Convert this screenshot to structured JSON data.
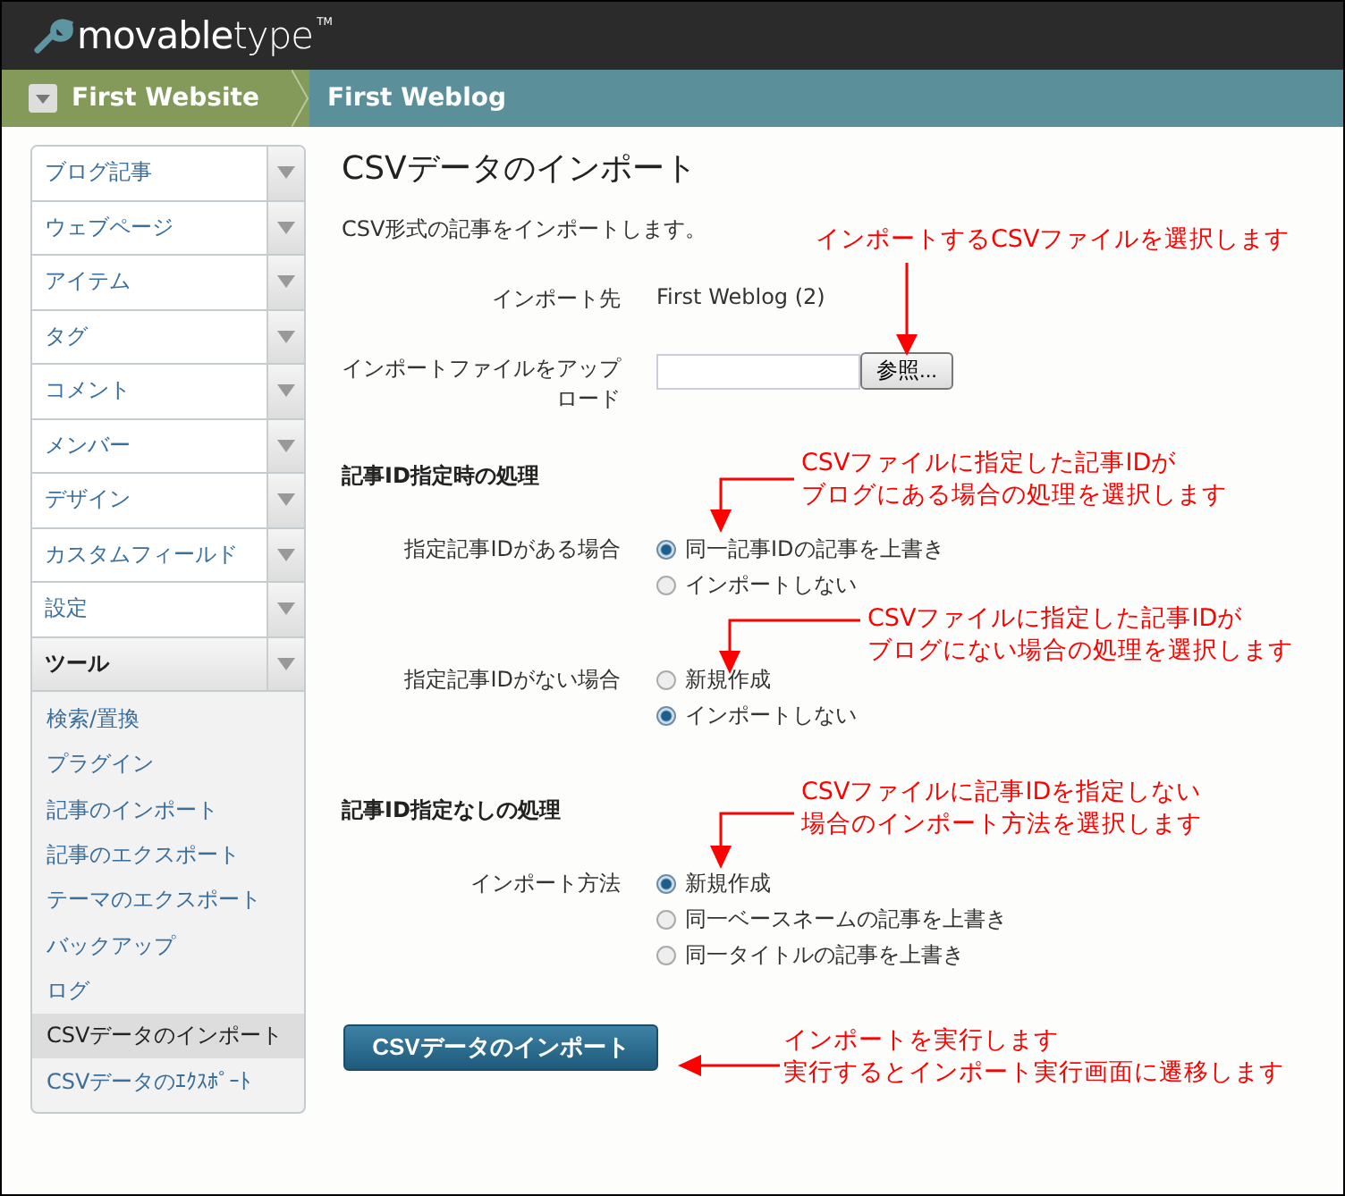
{
  "logo": {
    "text": "**movable**type",
    "tm": "TM"
  },
  "breadcrumb": [
    {
      "label": "First Website",
      "kind": "website"
    },
    {
      "label": "First Weblog",
      "kind": "blog"
    }
  ],
  "sidebar": {
    "menus": [
      {
        "label": "ブログ記事",
        "expanded": false
      },
      {
        "label": "ウェブページ",
        "expanded": false
      },
      {
        "label": "アイテム",
        "expanded": false
      },
      {
        "label": "タグ",
        "expanded": false
      },
      {
        "label": "コメント",
        "expanded": false
      },
      {
        "label": "メンバー",
        "expanded": false
      },
      {
        "label": "デザイン",
        "expanded": false
      },
      {
        "label": "カスタムフィールド",
        "expanded": false
      },
      {
        "label": "設定",
        "expanded": false
      },
      {
        "label": "ツール",
        "expanded": true,
        "children": [
          {
            "label": "検索/置換",
            "selected": false
          },
          {
            "label": "プラグイン",
            "selected": false
          },
          {
            "label": "記事のインポート",
            "selected": false
          },
          {
            "label": "記事のエクスポート",
            "selected": false
          },
          {
            "label": "テーマのエクスポート",
            "selected": false
          },
          {
            "label": "バックアップ",
            "selected": false
          },
          {
            "label": "ログ",
            "selected": false
          },
          {
            "label": "CSVデータのインポート",
            "selected": true
          },
          {
            "label": "CSVデータのｴｸｽﾎﾟｰﾄ",
            "selected": false
          }
        ]
      }
    ]
  },
  "page": {
    "title": "CSVデータのインポート",
    "description": "CSV形式の記事をインポートします。",
    "import_target": {
      "label": "インポート先",
      "value": "First Weblog (2)"
    },
    "upload": {
      "label": "インポートファイルをアップロード",
      "browse_button": "参照..."
    },
    "sections": [
      {
        "heading": "記事ID指定時の処理",
        "groups": [
          {
            "label": "指定記事IDがある場合",
            "options": [
              {
                "label": "同一記事IDの記事を上書き",
                "selected": true
              },
              {
                "label": "インポートしない",
                "selected": false
              }
            ]
          },
          {
            "label": "指定記事IDがない場合",
            "options": [
              {
                "label": "新規作成",
                "selected": false
              },
              {
                "label": "インポートしない",
                "selected": true
              }
            ]
          }
        ]
      },
      {
        "heading": "記事ID指定なしの処理",
        "groups": [
          {
            "label": "インポート方法",
            "options": [
              {
                "label": "新規作成",
                "selected": true
              },
              {
                "label": "同一ベースネームの記事を上書き",
                "selected": false
              },
              {
                "label": "同一タイトルの記事を上書き",
                "selected": false
              }
            ]
          }
        ]
      }
    ],
    "submit_button": "CSVデータのインポート"
  },
  "annotations": [
    {
      "lines": [
        "インポートするCSVファイルを選択します"
      ],
      "kind": "down"
    },
    {
      "lines": [
        "CSVファイルに指定した記事IDが",
        "ブログにある場合の処理を選択します"
      ],
      "kind": "elbow"
    },
    {
      "lines": [
        "CSVファイルに指定した記事IDが",
        "ブログにない場合の処理を選択します"
      ],
      "kind": "elbow"
    },
    {
      "lines": [
        "CSVファイルに記事IDを指定しない",
        "場合のインポート方法を選択します"
      ],
      "kind": "elbow"
    },
    {
      "lines": [
        "インポートを実行します",
        "実行するとインポート実行画面に遷移します"
      ],
      "kind": "left"
    }
  ]
}
